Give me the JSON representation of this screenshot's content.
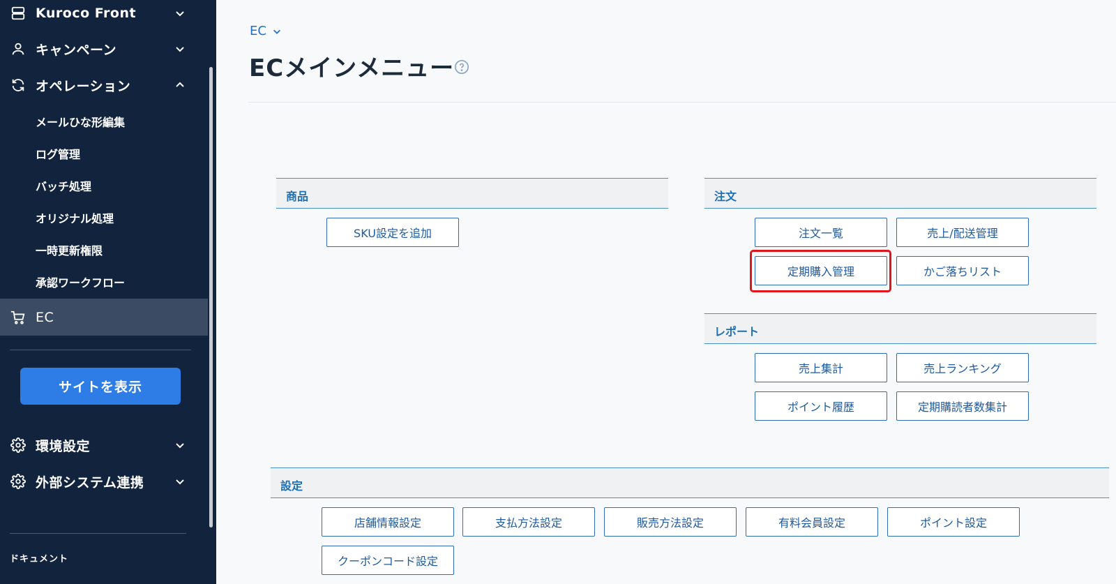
{
  "sidebar": {
    "items": [
      {
        "label": "Kuroco Front",
        "icon": "server-icon"
      },
      {
        "label": "キャンペーン",
        "icon": "user-icon"
      },
      {
        "label": "オペレーション",
        "icon": "refresh-icon"
      }
    ],
    "operation_sub": [
      "メールひな形編集",
      "ログ管理",
      "バッチ処理",
      "オリジナル処理",
      "一時更新権限",
      "承認ワークフロー"
    ],
    "ec_label": "EC",
    "site_button": "サイトを表示",
    "bottom_items": [
      {
        "label": "環境設定",
        "icon": "gear-icon"
      },
      {
        "label": "外部システム連携",
        "icon": "gear-icon"
      }
    ],
    "document_label": "ドキュメント"
  },
  "main": {
    "breadcrumb": "EC",
    "title": "ECメインメニュー",
    "sections": {
      "product": {
        "title": "商品",
        "buttons": [
          "SKU設定を追加"
        ]
      },
      "order": {
        "title": "注文",
        "buttons": [
          "注文一覧",
          "売上/配送管理",
          "定期購入管理",
          "かご落ちリスト"
        ]
      },
      "report": {
        "title": "レポート",
        "buttons": [
          "売上集計",
          "売上ランキング",
          "ポイント履歴",
          "定期購読者数集計"
        ]
      },
      "settings": {
        "title": "設定",
        "buttons": [
          "店舗情報設定",
          "支払方法設定",
          "販売方法設定",
          "有料会員設定",
          "ポイント設定",
          "クーポンコード設定"
        ]
      }
    }
  },
  "colors": {
    "sidebar_bg": "#12233d",
    "accent": "#2e7de6",
    "highlight": "#e0161c"
  }
}
